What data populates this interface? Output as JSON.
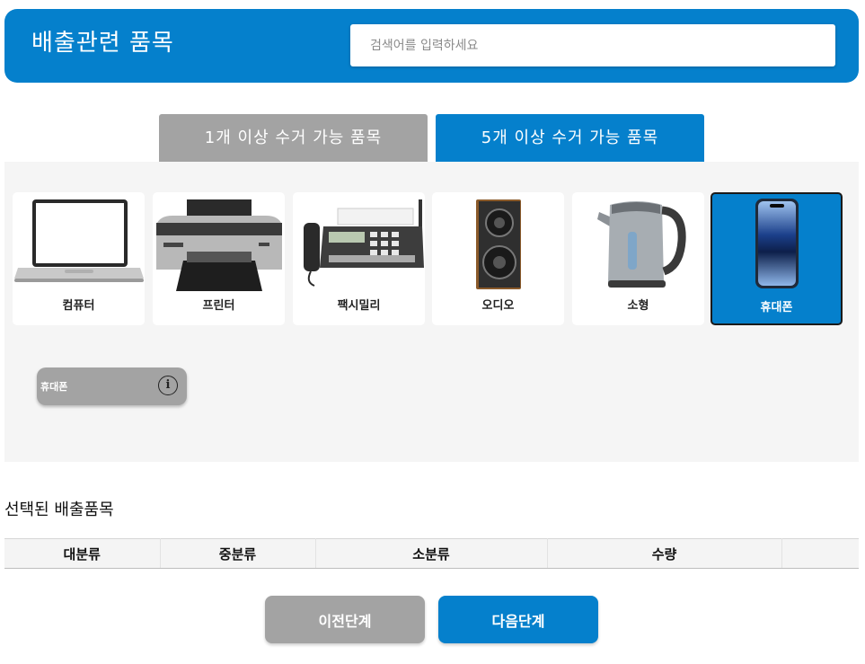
{
  "header": {
    "title": "배출관련 품목",
    "search_placeholder": "검색어를 입력하세요",
    "search_value": ""
  },
  "tabs": [
    {
      "label": "1개 이상 수거 가능 품목",
      "active": false
    },
    {
      "label": "5개 이상 수거 가능 품목",
      "active": true
    }
  ],
  "items": [
    {
      "label": "컴퓨터",
      "icon": "laptop-icon"
    },
    {
      "label": "프린터",
      "icon": "printer-icon"
    },
    {
      "label": "팩시밀리",
      "icon": "fax-icon"
    },
    {
      "label": "오디오",
      "icon": "speaker-icon"
    },
    {
      "label": "소형",
      "icon": "kettle-icon"
    },
    {
      "label": "휴대폰",
      "icon": "smartphone-icon",
      "selected": true
    }
  ],
  "chip": {
    "label": "휴대폰",
    "icon": "info-icon",
    "glyph": "i"
  },
  "selected_section": {
    "title": "선택된 배출품목",
    "columns": [
      "대분류",
      "중분류",
      "소분류",
      "수량",
      ""
    ]
  },
  "buttons": {
    "prev": "이전단계",
    "next": "다음단계"
  },
  "colors": {
    "primary": "#0580cc",
    "inactive": "#a3a3a3",
    "panel": "#f5f5f5"
  }
}
